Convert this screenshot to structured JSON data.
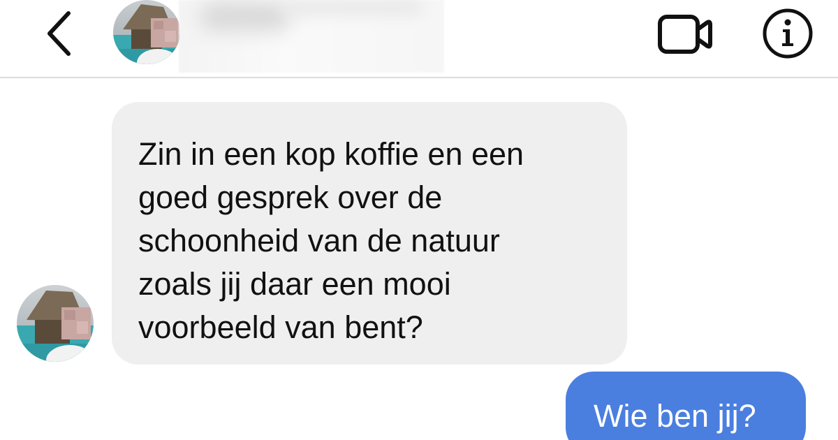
{
  "header": {
    "back_icon": "chevron-left-icon",
    "video_icon": "video-camera-icon",
    "info_icon": "info-circle-icon"
  },
  "messages": {
    "received": {
      "lines": [
        "Zin in een kop koffie en een",
        "goed gesprek over de",
        "schoonheid van de natuur",
        "zoals jij daar een mooi",
        "voorbeeld van bent?"
      ]
    },
    "sent": {
      "text": "Wie ben jij?"
    }
  },
  "colors": {
    "received_bubble": "#efefef",
    "sent_bubble": "#4a7fe0",
    "icon": "#111111"
  }
}
